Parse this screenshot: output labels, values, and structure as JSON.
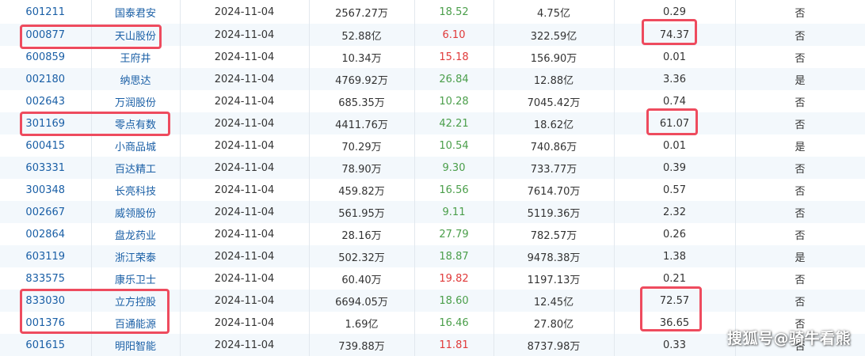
{
  "table": {
    "rows": [
      {
        "code": "601211",
        "name": "国泰君安",
        "date": "2024-11-04",
        "amount": "2567.27万",
        "pct": "18.52",
        "pct_dir": "pos",
        "cap": "4.75亿",
        "val": "0.29",
        "flag": "否"
      },
      {
        "code": "000877",
        "name": "天山股份",
        "date": "2024-11-04",
        "amount": "52.88亿",
        "pct": "6.10",
        "pct_dir": "neg",
        "cap": "322.59亿",
        "val": "74.37",
        "flag": "否"
      },
      {
        "code": "600859",
        "name": "王府井",
        "date": "2024-11-04",
        "amount": "10.34万",
        "pct": "15.18",
        "pct_dir": "neg",
        "cap": "156.90万",
        "val": "0.01",
        "flag": "否"
      },
      {
        "code": "002180",
        "name": "纳思达",
        "date": "2024-11-04",
        "amount": "4769.92万",
        "pct": "26.84",
        "pct_dir": "pos",
        "cap": "12.88亿",
        "val": "3.36",
        "flag": "是"
      },
      {
        "code": "002643",
        "name": "万润股份",
        "date": "2024-11-04",
        "amount": "685.35万",
        "pct": "10.28",
        "pct_dir": "pos",
        "cap": "7045.42万",
        "val": "0.74",
        "flag": "否"
      },
      {
        "code": "301169",
        "name": "零点有数",
        "date": "2024-11-04",
        "amount": "4411.76万",
        "pct": "42.21",
        "pct_dir": "pos",
        "cap": "18.62亿",
        "val": "61.07",
        "flag": "否"
      },
      {
        "code": "600415",
        "name": "小商品城",
        "date": "2024-11-04",
        "amount": "70.29万",
        "pct": "10.54",
        "pct_dir": "pos",
        "cap": "740.86万",
        "val": "0.01",
        "flag": "是"
      },
      {
        "code": "603331",
        "name": "百达精工",
        "date": "2024-11-04",
        "amount": "78.90万",
        "pct": "9.30",
        "pct_dir": "pos",
        "cap": "733.77万",
        "val": "0.39",
        "flag": "否"
      },
      {
        "code": "300348",
        "name": "长亮科技",
        "date": "2024-11-04",
        "amount": "459.82万",
        "pct": "16.56",
        "pct_dir": "pos",
        "cap": "7614.70万",
        "val": "0.57",
        "flag": "否"
      },
      {
        "code": "002667",
        "name": "威领股份",
        "date": "2024-11-04",
        "amount": "561.95万",
        "pct": "9.11",
        "pct_dir": "pos",
        "cap": "5119.36万",
        "val": "2.32",
        "flag": "否"
      },
      {
        "code": "002864",
        "name": "盘龙药业",
        "date": "2024-11-04",
        "amount": "28.16万",
        "pct": "27.79",
        "pct_dir": "pos",
        "cap": "782.57万",
        "val": "0.26",
        "flag": "否"
      },
      {
        "code": "603119",
        "name": "浙江荣泰",
        "date": "2024-11-04",
        "amount": "502.32万",
        "pct": "18.87",
        "pct_dir": "pos",
        "cap": "9478.38万",
        "val": "1.38",
        "flag": "是"
      },
      {
        "code": "833575",
        "name": "康乐卫士",
        "date": "2024-11-04",
        "amount": "60.40万",
        "pct": "19.82",
        "pct_dir": "neg",
        "cap": "1197.13万",
        "val": "0.21",
        "flag": "否"
      },
      {
        "code": "833030",
        "name": "立方控股",
        "date": "2024-11-04",
        "amount": "6694.05万",
        "pct": "18.60",
        "pct_dir": "pos",
        "cap": "12.45亿",
        "val": "72.57",
        "flag": "否"
      },
      {
        "code": "001376",
        "name": "百通能源",
        "date": "2024-11-04",
        "amount": "1.69亿",
        "pct": "16.46",
        "pct_dir": "pos",
        "cap": "27.80亿",
        "val": "36.65",
        "flag": "否"
      },
      {
        "code": "601615",
        "name": "明阳智能",
        "date": "2024-11-04",
        "amount": "739.88万",
        "pct": "11.81",
        "pct_dir": "neg",
        "cap": "8737.98万",
        "val": "0.33",
        "flag": "否"
      }
    ]
  },
  "watermark": "搜狐号@骑牛看熊",
  "colors": {
    "link": "#1a5fa6",
    "positive": "#4a9e4a",
    "negative": "#e03a3a",
    "highlight": "#ee4b5e",
    "stripe": "#f3f8fc"
  }
}
